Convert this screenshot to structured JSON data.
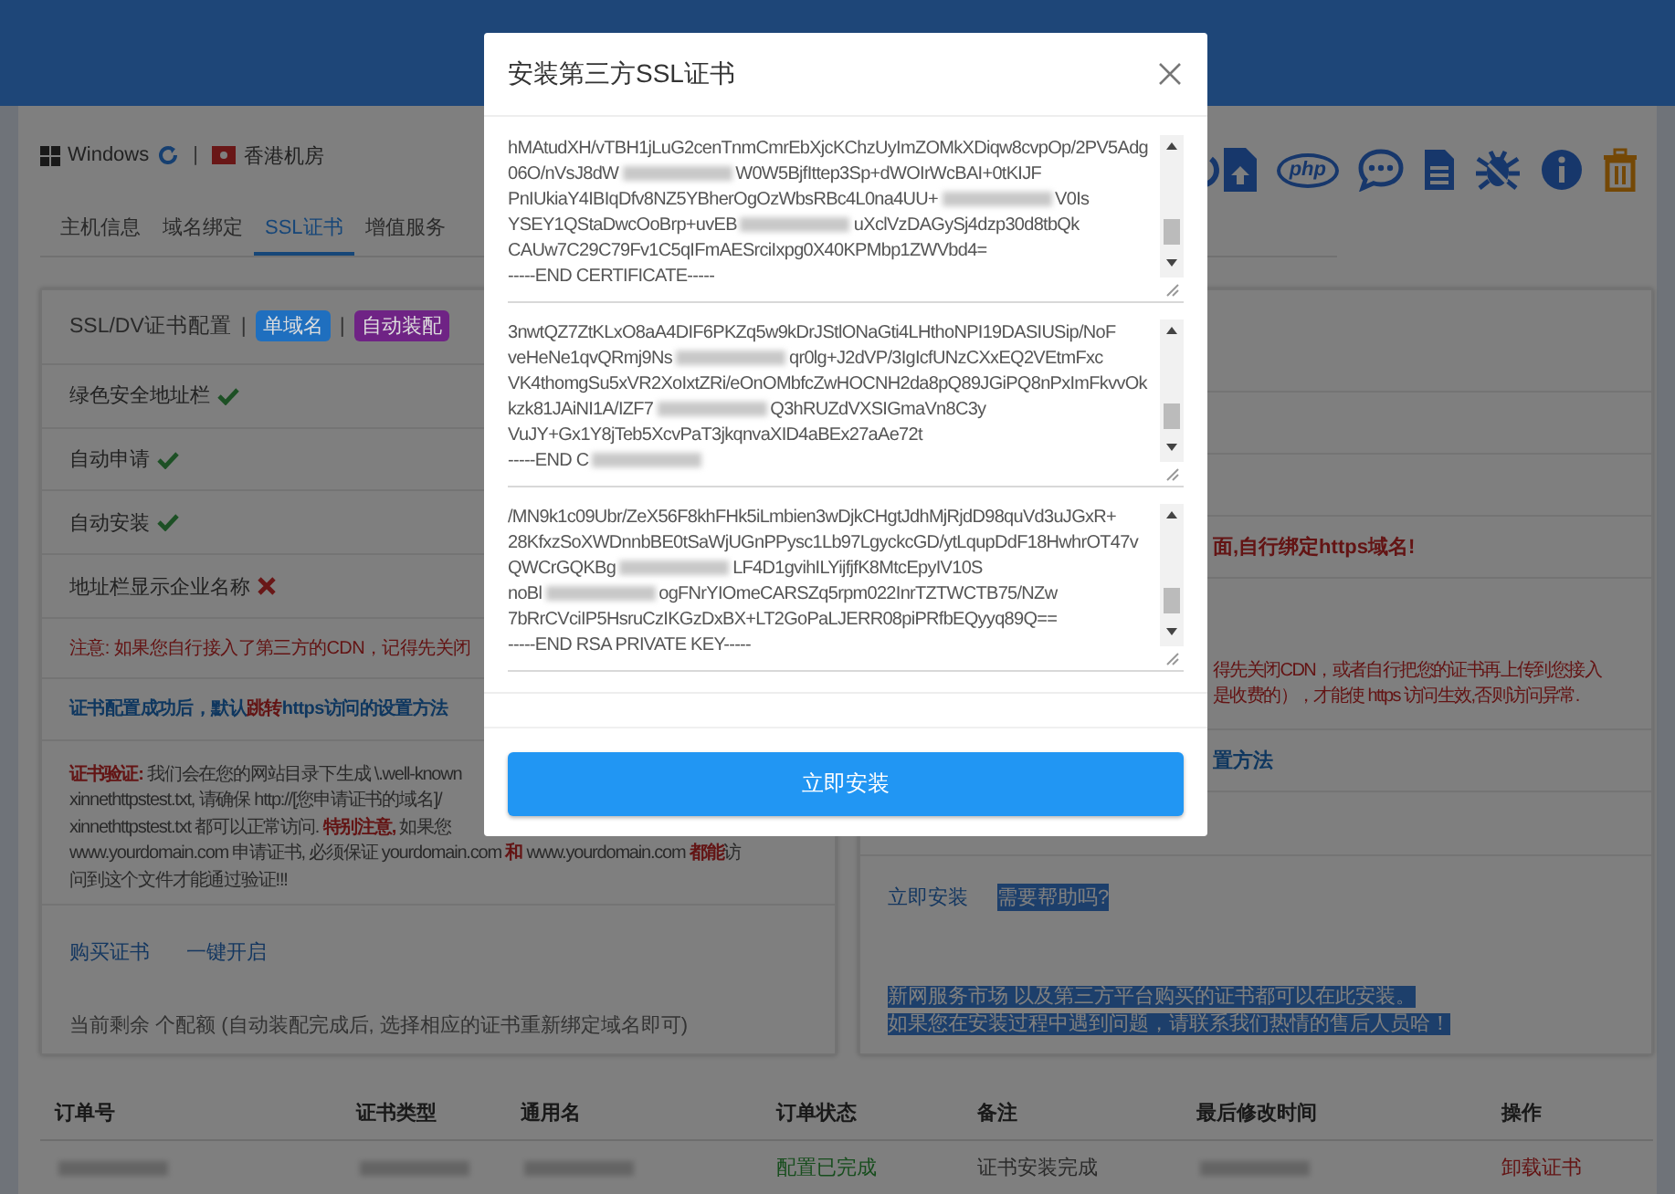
{
  "host": {
    "os": "Windows",
    "separator": "|",
    "region": "香港机房"
  },
  "toolbar": {
    "php": "php"
  },
  "tabs": [
    {
      "label": "主机信息",
      "selected": false
    },
    {
      "label": "域名绑定",
      "selected": false
    },
    {
      "label": "SSL证书",
      "selected": true
    },
    {
      "label": "增值服务",
      "selected": false
    }
  ],
  "left_card": {
    "title": "SSL/DV证书配置",
    "separator": "|",
    "tags": [
      {
        "label": "单域名",
        "color": "#1f6fbf"
      },
      {
        "label": "自动装配",
        "color": "#6f2385"
      }
    ],
    "features": [
      {
        "label": "绿色安全地址栏",
        "supported": true
      },
      {
        "label": "自动申请",
        "supported": true
      },
      {
        "label": "自动安装",
        "supported": true
      },
      {
        "label": "地址栏显示企业名称",
        "supported": false
      }
    ],
    "notice": "注意: 如果您自行接入了第三方的CDN，记得先关闭",
    "howto": "证书配置成功后，默认**跳转**https访问的设置方法",
    "verification": [
      "**证书验证:** 我们会在您的网站目录下生成 \\.well-known",
      "xinnethttpstest.txt, 请确保 http://[您申请证书的域名]/",
      "xinnethttpstest.txt 都可以正常访问. **特别注意,** 如果您",
      "www.yourdomain.com 申请证书, 必须保证 yourdomain.com **和** www.yourdomain.com **都能**访",
      "问到这个文件才能通过验证!!!"
    ],
    "links": [
      "购买证书",
      "一键开启"
    ],
    "quota": "当前剩余 个配额 (自动装配完成后, 选择相应的证书重新绑定域名即可)"
  },
  "right_card": {
    "domain_tip": "面,自行绑定https域名!",
    "cdn_tip": [
      "得先关闭CDN，或者自行把您的证书再上传到您接入",
      "是收费的），才能使 https 访问生效,否则访问异常."
    ],
    "howto": "置方法",
    "links": [
      {
        "label": "立即安装",
        "highlighted": false
      },
      {
        "label": "需要帮助吗?",
        "highlighted": true
      }
    ],
    "notes": [
      {
        "text": "新网服务市场 以及第三方平台购买的证书都可以在此安装。",
        "highlighted": true
      },
      {
        "text": "如果您在安装过程中遇到问题，请联系我们热情的售后人员哈！",
        "highlighted": true
      }
    ]
  },
  "table": {
    "columns": [
      "订单号",
      "证书类型",
      "通用名",
      "订单状态",
      "备注",
      "最后修改时间",
      "操作"
    ],
    "rows": [
      {
        "cells": [
          {
            "kind": "blurred"
          },
          {
            "kind": "blurred"
          },
          {
            "kind": "blurred"
          },
          {
            "kind": "status",
            "text": "配置已完成"
          },
          {
            "kind": "text",
            "text": "证书安装完成"
          },
          {
            "kind": "blurred"
          },
          {
            "kind": "link",
            "text": "卸载证书"
          }
        ]
      }
    ]
  },
  "modal": {
    "title": "安装第三方SSL证书",
    "fields": [
      {
        "lines": [
          [
            "hMAtudXH/vTBH1jLuG2cenTnmCmrEbXjcKChzUyImZOMkXDiqw8cvpOp/2PV5Adg"
          ],
          [
            "06O/nVsJ8dW",
            {
              "kind": "blurred"
            },
            "W0W5BjfIttep3Sp+dWOIrWcBAI+0tKIJF"
          ],
          [
            "PnIUkiaY4IBIqDfv8NZ5YBherOgOzWbsRBc4L0na4UU+",
            {
              "kind": "blurred"
            },
            "V0Is"
          ],
          [
            "YSEY1QStaDwcOoBrp+uvEB",
            {
              "kind": "blurred"
            },
            "uXclVzDAGySj4dzp30d8tbQk"
          ],
          [
            "CAUw7C29C79Fv1C5qIFmAESrciIxpg0X40KPMbp1ZWVbd4="
          ],
          [
            "-----END CERTIFICATE-----"
          ]
        ]
      },
      {
        "lines": [
          [
            "3nwtQZ7ZtKLxO8aA4DIF6PKZq5w9kDrJStlONaGti4LHthoNPI19DASIUSip/NoF"
          ],
          [
            "veHeNe1qvQRmj9Ns",
            {
              "kind": "blurred"
            },
            "qr0lg+J2dVP/3IgIcfUNzCXxEQ2VEtmFxc"
          ],
          [
            "VK4thomgSu5xVR2XoIxtZRi/eOnOMbfcZwHOCNH2da8pQ89JGiPQ8nPxImFkvvOk"
          ],
          [
            "kzk81JAiNI1A/IZF7",
            {
              "kind": "blurred"
            },
            "Q3hRUZdVXSIGmaVn8C3y"
          ],
          [
            "VuJY+Gx1Y8jTeb5XcvPaT3jkqnvaXID4aBEx27aAe72t"
          ],
          [
            "-----END C",
            {
              "kind": "blurred"
            }
          ]
        ]
      },
      {
        "lines": [
          [
            "/MN9k1c09Ubr/ZeX56F8khFHk5iLmbien3wDjkCHgtJdhMjRjdD98quVd3uJGxR+"
          ],
          [
            "28KfxzSoXWDnnbBE0tSaWjUGnPPysc1Lb97LgyckcGD/ytLqupDdF18HwhrOT47v"
          ],
          [
            "QWCrGQKBg",
            {
              "kind": "blurred"
            },
            "LF4D1gvihILYijfjfK8MtcEpyIV10S"
          ],
          [
            "noBl",
            {
              "kind": "blurred"
            },
            "ogFNrYIOmeCARSZq5rpm022InrTZTWCTB75/NZw"
          ],
          [
            "7bRrCVciIP5HsruCzIKGzDxBX+LT2GoPaLJERR08piPRfbEQyyq89Q=="
          ],
          [
            "-----END RSA PRIVATE KEY-----"
          ]
        ]
      }
    ],
    "submit": "立即安装"
  }
}
